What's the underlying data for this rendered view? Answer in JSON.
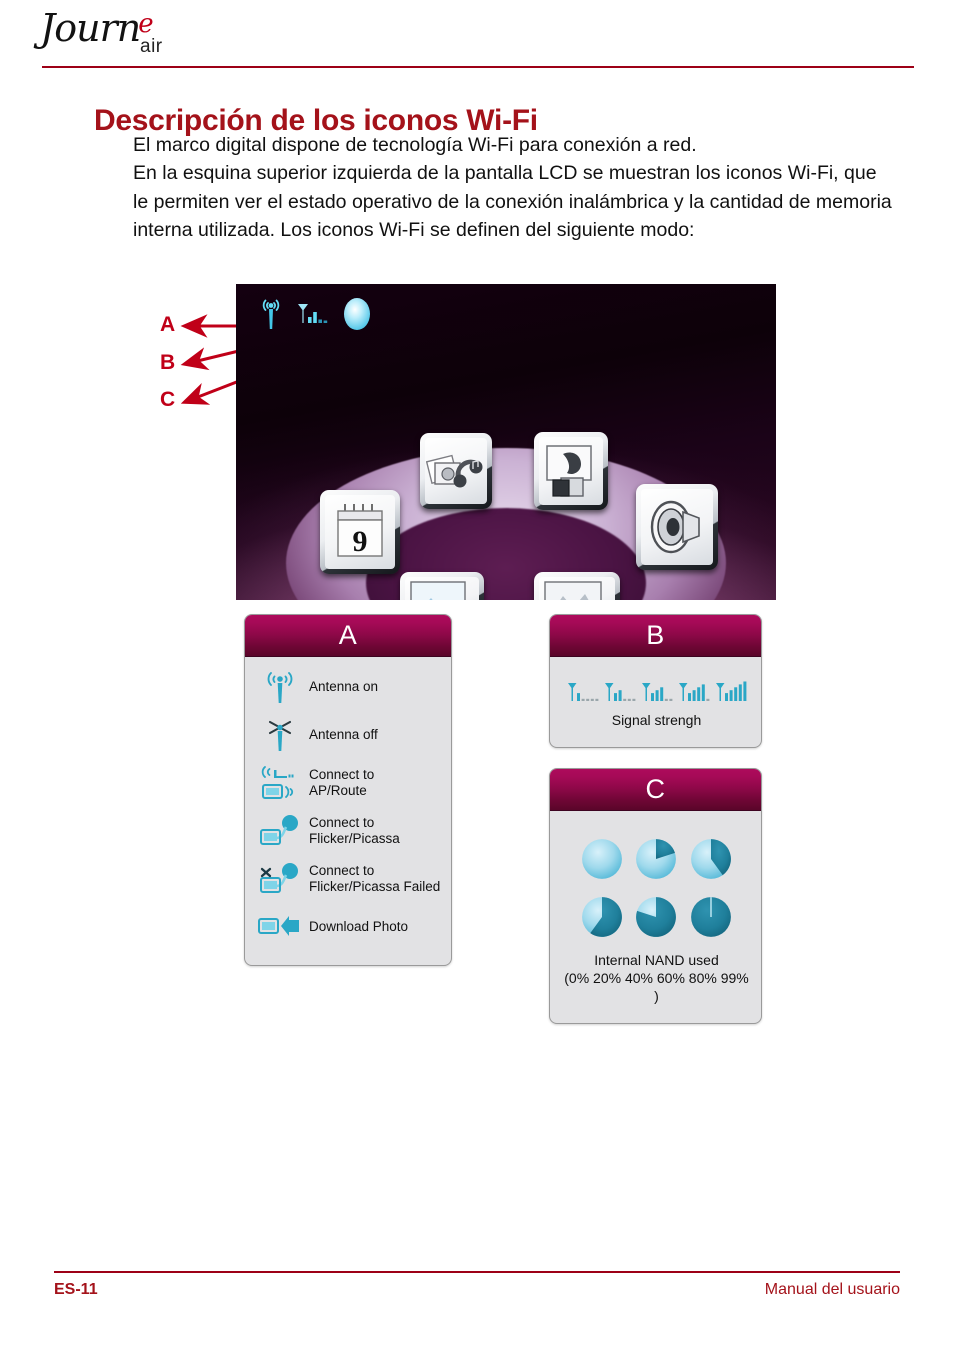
{
  "header": {
    "logo_word": "Journ",
    "logo_accent": "e",
    "logo_sub": "air"
  },
  "title": "Descripción de los iconos Wi-Fi",
  "body": {
    "line1": "El marco digital dispone de tecnología Wi-Fi para conexión a red.",
    "line2": "En la esquina superior izquierda de la pantalla LCD se muestran los iconos Wi-Fi, que le permiten ver el estado operativo de la conexión inalámbrica y la cantidad de memoria interna utilizada. Los iconos Wi-Fi se definen del siguiente modo:"
  },
  "callouts": {
    "a": "A",
    "b": "B",
    "c": "C"
  },
  "lcd": {
    "status_icons": [
      "antenna-tower-icon",
      "signal-bars-icon",
      "nand-pie-icon"
    ],
    "apps": [
      {
        "name": "calendar",
        "label": "9"
      },
      {
        "name": "photo-music",
        "label": ""
      },
      {
        "name": "video",
        "label": ""
      },
      {
        "name": "speaker",
        "label": ""
      },
      {
        "name": "photo-viewer-left",
        "label": ""
      },
      {
        "name": "photo-viewer-right",
        "label": ""
      }
    ]
  },
  "panel_a": {
    "header": "A",
    "rows": [
      {
        "icon": "antenna-on-icon",
        "label": "Antenna on"
      },
      {
        "icon": "antenna-off-icon",
        "label": "Antenna off"
      },
      {
        "icon": "connect-ap-icon",
        "label": "Connect to\nAP/Route"
      },
      {
        "icon": "connect-cloud-icon",
        "label": "Connect to\nFlicker/Picassa"
      },
      {
        "icon": "connect-cloud-failed-icon",
        "label": "Connect to\nFlicker/Picassa Failed"
      },
      {
        "icon": "download-photo-icon",
        "label": "Download Photo"
      }
    ]
  },
  "panel_b": {
    "header": "B",
    "caption": "Signal strengh",
    "levels": [
      1,
      2,
      3,
      4,
      5
    ],
    "bar_slots": 5
  },
  "panel_c": {
    "header": "C",
    "caption_line1": "Internal NAND used",
    "caption_line2": "(0% 20% 40% 60% 80% 99% )",
    "percentages": [
      0,
      20,
      40,
      60,
      80,
      99
    ]
  },
  "footer": {
    "left": "ES-11",
    "right": "Manual del usuario"
  },
  "colors": {
    "accent_red": "#a4121a",
    "rule_red": "#9d0016",
    "panel_header_top": "#ae0b5c",
    "panel_header_bottom": "#5a0529",
    "icon_cyan": "#2aa7c6",
    "pie_dark": "#1c7f99",
    "pie_light": "#8fd2e8"
  }
}
